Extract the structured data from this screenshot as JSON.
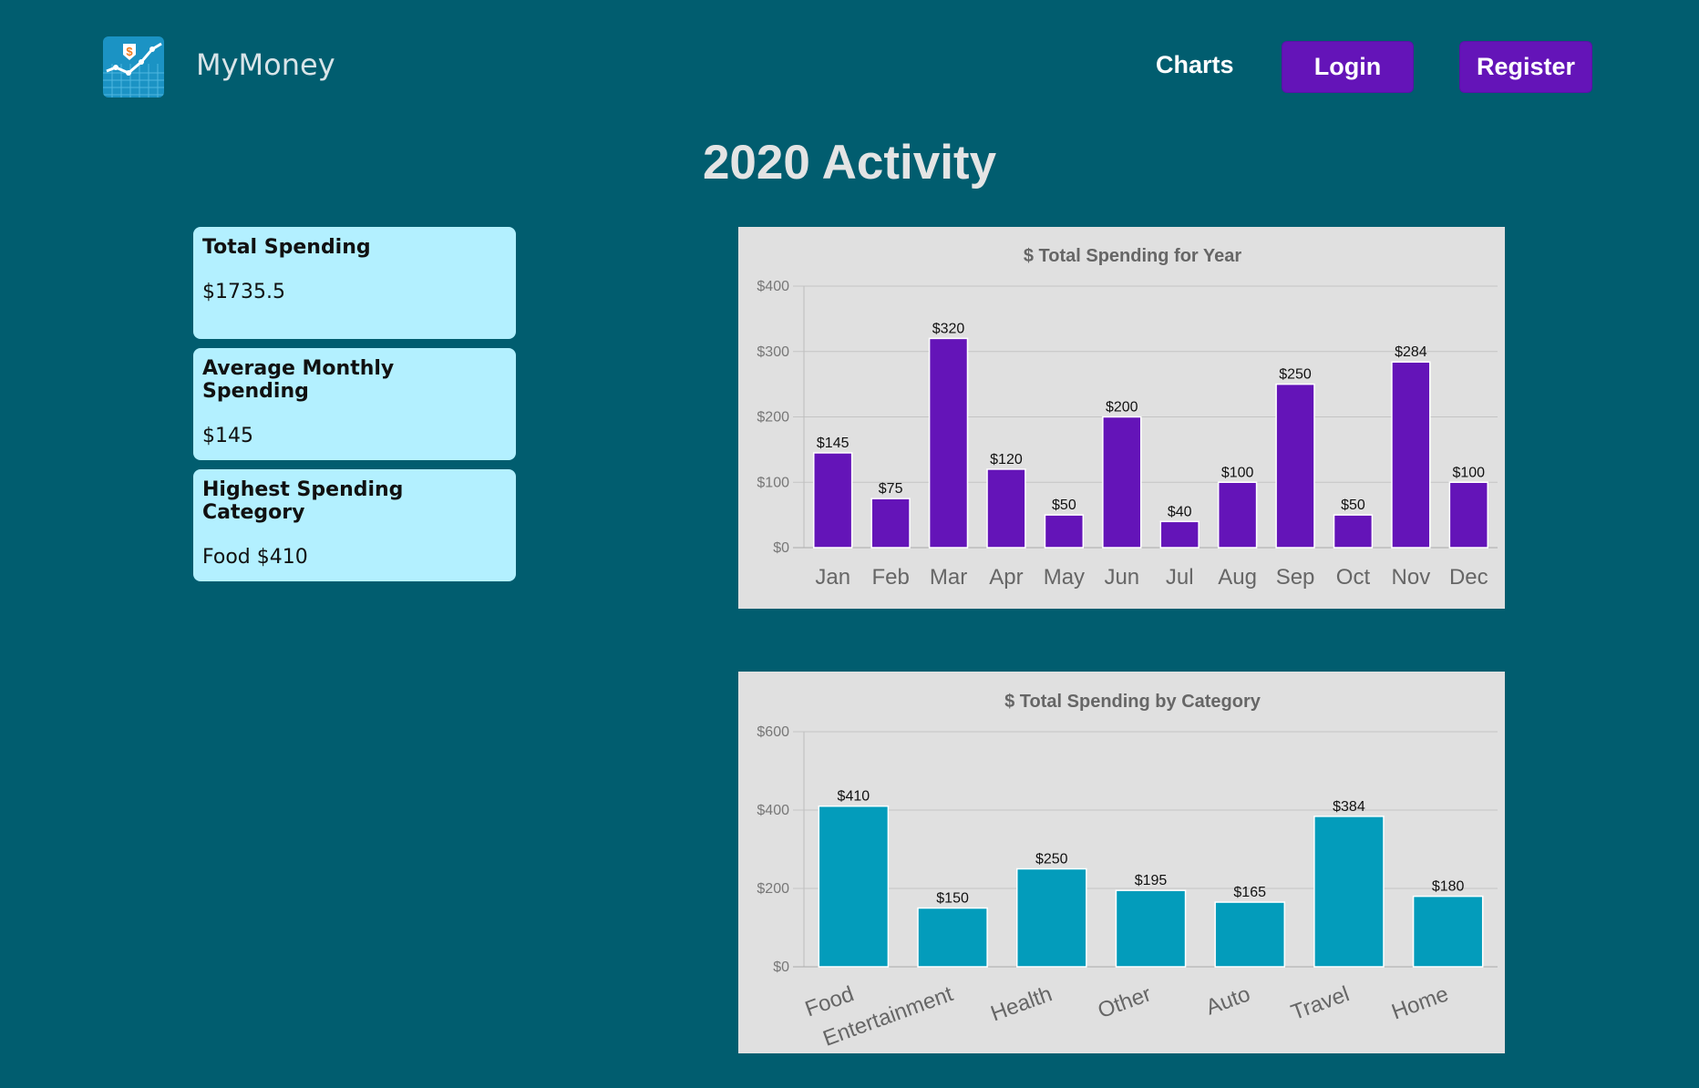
{
  "header": {
    "brand": "MyMoney",
    "nav_charts": "Charts",
    "login_label": "Login",
    "register_label": "Register",
    "logo_icon": "dollar-trend-icon"
  },
  "page_title": "2020 Activity",
  "cards": [
    {
      "label": "Total Spending",
      "value": "$1735.5"
    },
    {
      "label": "Average Monthly Spending",
      "value": "$145"
    },
    {
      "label": "Highest Spending Category",
      "value": "Food $410"
    }
  ],
  "colors": {
    "background": "#015d6f",
    "accent": "#6414b8",
    "card": "#b3f0ff",
    "bar_month": "#6414b8",
    "bar_category": "#039cbb"
  },
  "chart_data": [
    {
      "type": "bar",
      "title": "$ Total Spending for Year",
      "categories": [
        "Jan",
        "Feb",
        "Mar",
        "Apr",
        "May",
        "Jun",
        "Jul",
        "Aug",
        "Sep",
        "Oct",
        "Nov",
        "Dec"
      ],
      "values": [
        145,
        75,
        320,
        120,
        50,
        200,
        40,
        100,
        250,
        50,
        284,
        100
      ],
      "data_labels": [
        "$145",
        "$75",
        "$320",
        "$120",
        "$50",
        "$200",
        "$40",
        "$100",
        "$250",
        "$50",
        "$284",
        "$100"
      ],
      "ylim": [
        0,
        400
      ],
      "yticks": [
        0,
        100,
        200,
        300,
        400
      ],
      "ytick_labels": [
        "$0",
        "$100",
        "$200",
        "$300",
        "$400"
      ],
      "grid": true,
      "color": "#6414b8"
    },
    {
      "type": "bar",
      "title": "$ Total Spending by Category",
      "categories": [
        "Food",
        "Entertainment",
        "Health",
        "Other",
        "Auto",
        "Travel",
        "Home"
      ],
      "values": [
        410,
        150,
        250,
        195,
        165,
        384,
        180
      ],
      "data_labels": [
        "$410",
        "$150",
        "$250",
        "$195",
        "$165",
        "$384",
        "$180"
      ],
      "ylim": [
        0,
        600
      ],
      "yticks": [
        0,
        200,
        400,
        600
      ],
      "ytick_labels": [
        "$0",
        "$200",
        "$400",
        "$600"
      ],
      "grid": true,
      "rotated_labels": true,
      "color": "#039cbb"
    }
  ]
}
